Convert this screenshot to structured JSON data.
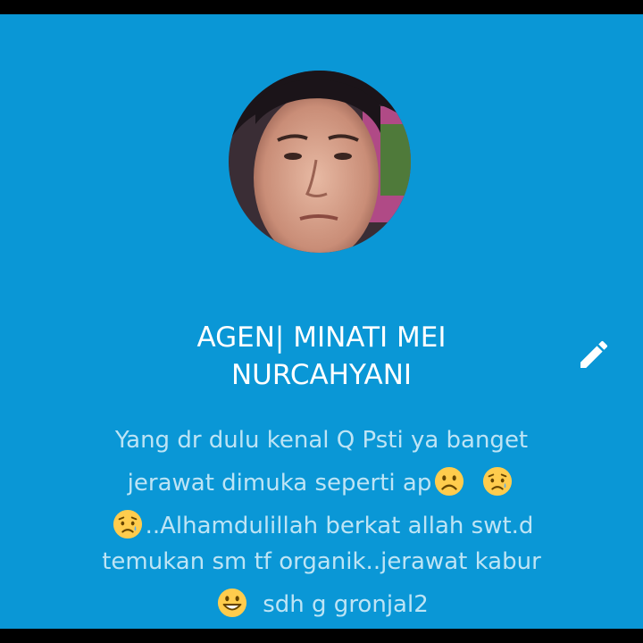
{
  "profile": {
    "name_line1": "AGEN| MINATI MEI",
    "name_line2": "NURCAHYANI",
    "bio": {
      "line1": "Yang dr dulu kenal Q Psti ya banget",
      "line2": "jerawat dimuka seperti ap",
      "line3": "..Alhamdulillah berkat allah swt.d",
      "line4": "temukan sm tf organik..jerawat kabur",
      "line5": "sdh g gronjal2"
    },
    "emojis": [
      "frowning-face",
      "sad-tear-face",
      "sad-tear-face",
      "grinning-face"
    ]
  },
  "colors": {
    "background": "#0A97D6",
    "name_text": "#FFFFFF",
    "bio_text": "#BDE4F5",
    "frame": "#000000"
  },
  "icons": {
    "edit": "pencil-icon",
    "avatar": "profile-photo"
  }
}
